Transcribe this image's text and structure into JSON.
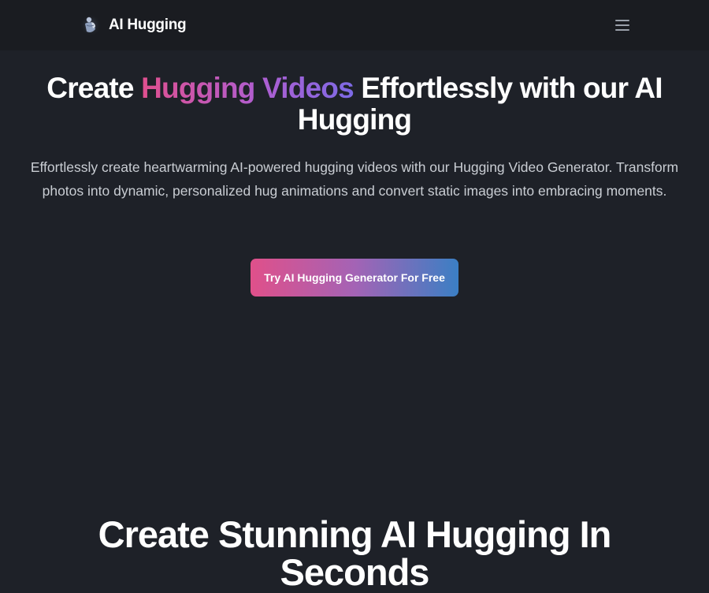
{
  "header": {
    "brand_name": "AI Hugging",
    "logo_icon": "hug-figure-logo-icon",
    "menu_icon": "hamburger-menu-icon"
  },
  "hero": {
    "title_part1": "Create ",
    "title_highlight": "Hugging Videos",
    "title_part2": " Effortlessly with our AI Hugging",
    "description": "Effortlessly create heartwarming AI-powered hugging videos with our Hugging Video Generator. Transform photos into dynamic, personalized hug animations and convert static images into embracing moments.",
    "cta_label": "Try AI Hugging Generator For Free"
  },
  "section": {
    "title": "Create Stunning AI Hugging In Seconds"
  },
  "colors": {
    "background": "#1e2128",
    "header_background": "#1a1c21",
    "gradient_pink": "#e0508a",
    "gradient_purple": "#a463b5",
    "gradient_blue": "#3b7fc4"
  }
}
